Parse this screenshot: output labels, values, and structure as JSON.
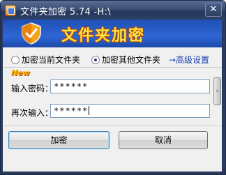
{
  "window": {
    "title": "文件夹加密 5.74 -H:\\",
    "close_glyph": "✕"
  },
  "banner": {
    "title": "文件夹加密",
    "icon": "shield-checkmark-icon"
  },
  "options": {
    "radio_current": "加密当前文件夹",
    "radio_other": "加密其他文件夹",
    "selected": "radio_other",
    "advanced": "→高级设置"
  },
  "badge": {
    "new": "New"
  },
  "form": {
    "password_label": "输入密码：",
    "password_value": "******",
    "confirm_label": "再次输入：",
    "confirm_value": "******"
  },
  "buttons": {
    "encrypt": "加密",
    "cancel": "取消"
  },
  "colors": {
    "banner_blue": "#2e66d6",
    "banner_text": "#ffe14a",
    "title_bar": "#2b3a5c",
    "link": "#1b3fb0"
  }
}
